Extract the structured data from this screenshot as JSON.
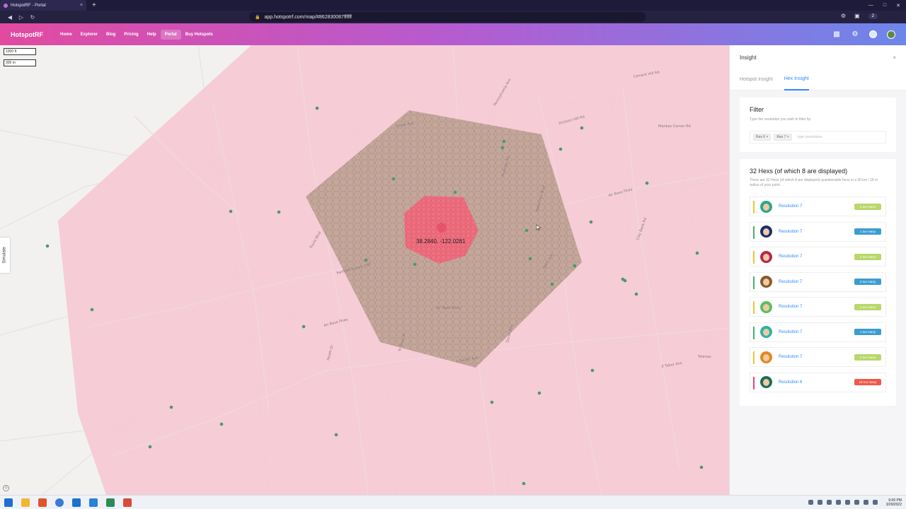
{
  "browser": {
    "tab_title": "HotspotRF - Portal",
    "url": "app.hotspotrf.com/map/#862830087ffffff",
    "profile_count": "2",
    "tab_close": "×",
    "new_tab": "+"
  },
  "app": {
    "brand": "HotspotRF",
    "menu": [
      "Home",
      "Explorer",
      "Blog",
      "Pricing",
      "Help",
      "Portal",
      "Buy Hotspots"
    ],
    "active_menu": "Portal"
  },
  "map": {
    "scale_ft": "1000 ft",
    "scale_m": "300 m",
    "coordinate": "38.2840, -122.0281",
    "simulate_label": "Simulate",
    "labels": [
      {
        "t": "Air Base Pkwy"
      },
      {
        "t": "Air Base Pkwy"
      },
      {
        "t": "Air Base Pkwy"
      },
      {
        "t": "Travis Blvd"
      },
      {
        "t": "Dickson Hill Rd"
      },
      {
        "t": "Mankas Corner Rd"
      },
      {
        "t": "Dover Ave"
      },
      {
        "t": "N Texas St"
      },
      {
        "t": "E Tabor Ave"
      },
      {
        "t": "Tolenas"
      },
      {
        "t": "Fairfield-Suisun USD"
      },
      {
        "t": "Cement Hill Rd"
      },
      {
        "t": "Peabody Rd"
      },
      {
        "t": "Pennsylvania Ave"
      },
      {
        "t": "Clay Bank Rd"
      },
      {
        "t": "Waterman Blvd"
      },
      {
        "t": "E Pacific Ave"
      },
      {
        "t": "Heath Dr"
      },
      {
        "t": "Beck Ave"
      },
      {
        "t": "Union Ave"
      }
    ]
  },
  "panel": {
    "header": "Insight",
    "close": "×",
    "tabs": [
      "Hotspot Insight",
      "Hex Insight"
    ],
    "active_tab": "Hex Insight",
    "filter": {
      "title": "Filter",
      "subtitle": "Type the resolution you wish to filter by.",
      "chips": [
        "Res 6",
        "Res 7"
      ],
      "placeholder": "type resolutions"
    },
    "hexes": {
      "title": "32 Hexs (of which 8 are displayed)",
      "subtitle": "There are 32 Hexs (of which 8 are displayed) questionable hexs in a 30 km / 18 m radius of your point.",
      "items": [
        {
          "label": "Resolution 7",
          "badge": "4 too many",
          "color": "#f4c430",
          "badge_bg": "#b7d86b",
          "av": "#2ca58d"
        },
        {
          "label": "Resolution 7",
          "badge": "1 too many",
          "color": "#45b36b",
          "badge_bg": "#3c9cd2",
          "av": "#1c2e6b"
        },
        {
          "label": "Resolution 7",
          "badge": "4 too many",
          "color": "#f4c430",
          "badge_bg": "#b7d86b",
          "av": "#b8274a"
        },
        {
          "label": "Resolution 7",
          "badge": "2 too many",
          "color": "#45b36b",
          "badge_bg": "#3c9cd2",
          "av": "#8a5a2b"
        },
        {
          "label": "Resolution 7",
          "badge": "4 too many",
          "color": "#f4c430",
          "badge_bg": "#b7d86b",
          "av": "#5cbf60"
        },
        {
          "label": "Resolution 7",
          "badge": "1 too many",
          "color": "#45b36b",
          "badge_bg": "#3c9cd2",
          "av": "#2ab5a8"
        },
        {
          "label": "Resolution 7",
          "badge": "4 too many",
          "color": "#f4c430",
          "badge_bg": "#b7d86b",
          "av": "#e08a1e"
        },
        {
          "label": "Resolution 6",
          "badge": "16 too many",
          "color": "#e2457a",
          "badge_bg": "#f0584a",
          "av": "#1a6f5a"
        }
      ]
    }
  },
  "taskbar": {
    "time": "6:00 PM",
    "date": "3/29/2022"
  },
  "colors": {
    "brand_start": "#e24aa0",
    "brand_end": "#6d86ea",
    "coverage": "#f7c6d2",
    "hex_region": "#b99e8e",
    "hotspot_hex": "#f26b7d",
    "accent": "#2d8cff"
  }
}
